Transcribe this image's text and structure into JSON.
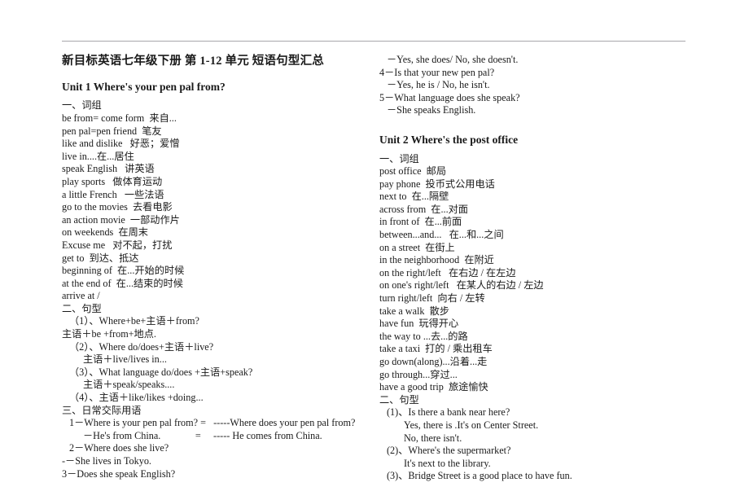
{
  "document": {
    "title": "新目标英语七年级下册 第 1-12 单元 短语句型汇总"
  },
  "left_column": {
    "unit1": {
      "heading": "Unit 1 Where's your pen pal from?",
      "section_vocab_label": "一、词组",
      "vocab": [
        "be from= come form  来自...",
        "pen pal=pen friend  笔友",
        "like and dislike   好恶；爱憎",
        "live in....在...居住",
        "speak English   讲英语",
        "play sports   做体育运动",
        "a little French   一些法语",
        "go to the movies  去看电影",
        "an action movie  一部动作片",
        "on weekends  在周末",
        "Excuse me   对不起，打扰",
        "get to  到达、抵达",
        "beginning of  在...开始的时候",
        "at the end of  在...结束的时候",
        "arrive at /"
      ],
      "section_pattern_label": "二、句型",
      "patterns": [
        {
          "text": "（1）、Where+be+主语＋from?",
          "indent": 1
        },
        {
          "text": "主语＋be +from+地点.",
          "indent": 0
        },
        {
          "text": "（2）、Where do/does+主语＋live?",
          "indent": 1
        },
        {
          "text": "主语＋live/lives in...",
          "indent": 2
        },
        {
          "text": "（3）、What language do/does +主语+speak?",
          "indent": 1
        },
        {
          "text": "主语＋speak/speaks....",
          "indent": 2
        },
        {
          "text": "（4）、主语＋like/likes +doing...",
          "indent": 1
        }
      ],
      "section_dialog_label": "三、日常交际用语",
      "dialog": [
        {
          "text": "1－Where is your pen pal from? =   -----Where does your pen pal from?",
          "indent": 1
        },
        {
          "text": "－He's from China.              =     ----- He comes from China.",
          "indent": 2
        },
        {
          "text": "2－Where does she live?",
          "indent": 1
        },
        {
          "text": "-－She lives in Tokyo.",
          "indent": 0
        },
        {
          "text": "3－Does she speak English?",
          "indent": 0
        }
      ]
    }
  },
  "right_column": {
    "unit1_continued": [
      {
        "text": "－Yes, she does/ No, she doesn't.",
        "indent": 1
      },
      {
        "text": "4－Is that your new pen pal?",
        "indent": 0
      },
      {
        "text": "－Yes, he is / No, he isn't.",
        "indent": 1
      },
      {
        "text": "5－What language does she speak?",
        "indent": 0
      },
      {
        "text": "－She speaks English.",
        "indent": 1
      }
    ],
    "unit2": {
      "heading": "Unit 2 Where's the post office",
      "section_vocab_label": "一、词组",
      "vocab": [
        "post office  邮局",
        "pay phone  投币式公用电话",
        "next to  在...隔壁",
        "across from  在...对面",
        "in front of  在...前面",
        "between...and...   在...和...之间",
        "on a street  在街上",
        "in the neighborhood  在附近",
        "on the right/left   在右边 / 在左边",
        "on one's right/left   在某人的右边 / 左边",
        "turn right/left  向右 / 左转",
        "take a walk  散步",
        "have fun  玩得开心",
        "the way to ...去...的路",
        "take a taxi  打的 / 乘出租车",
        "go down(along)...沿着...走",
        "go through...穿过...",
        "have a good trip  旅途愉快"
      ],
      "section_pattern_label": "二、句型",
      "patterns": [
        {
          "text": "(1)、Is there a bank near here?",
          "indent": 1
        },
        {
          "text": "Yes, there is .It's on Center Street.",
          "indent": 3
        },
        {
          "text": "No, there isn't.",
          "indent": 3
        },
        {
          "text": "(2)、Where's the supermarket?",
          "indent": 1
        },
        {
          "text": "It's next to the library.",
          "indent": 3
        },
        {
          "text": "(3)、Bridge Street is a good place to have fun.",
          "indent": 1
        }
      ]
    }
  }
}
